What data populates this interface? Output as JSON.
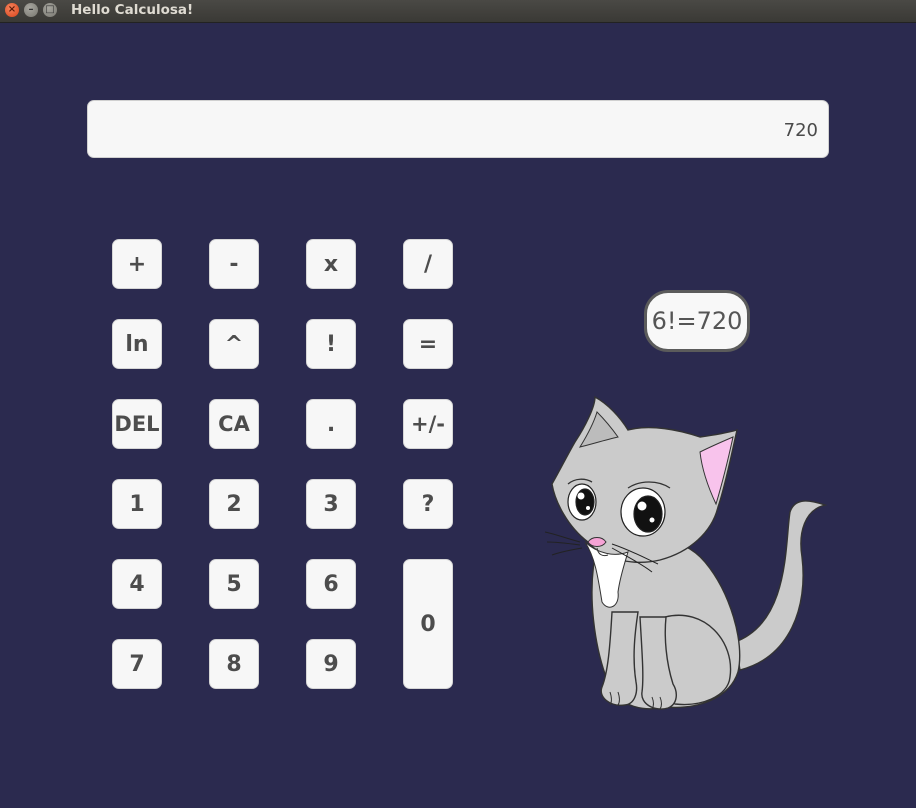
{
  "window": {
    "title": "Hello Calculosa!",
    "close_glyph": "×",
    "min_glyph": "–",
    "max_glyph": "□"
  },
  "display": {
    "value": "720"
  },
  "keys": {
    "plus": "+",
    "minus": "-",
    "multiply": "x",
    "divide": "/",
    "ln": "ln",
    "power": "^",
    "factorial": "!",
    "equals": "=",
    "delete": "DEL",
    "clear_all": "CA",
    "decimal": ".",
    "negate": "+/-",
    "one": "1",
    "two": "2",
    "three": "3",
    "help": "?",
    "four": "4",
    "five": "5",
    "six": "6",
    "zero": "0",
    "seven": "7",
    "eight": "8",
    "nine": "9"
  },
  "speech_bubble": {
    "text": "6!=720"
  },
  "colors": {
    "background": "#2b2a4f",
    "key": "#f7f7f7",
    "key_text": "#4d4d4d",
    "cat_body": "#cbcbcb",
    "cat_ear_inner": "#f8c3ec"
  }
}
